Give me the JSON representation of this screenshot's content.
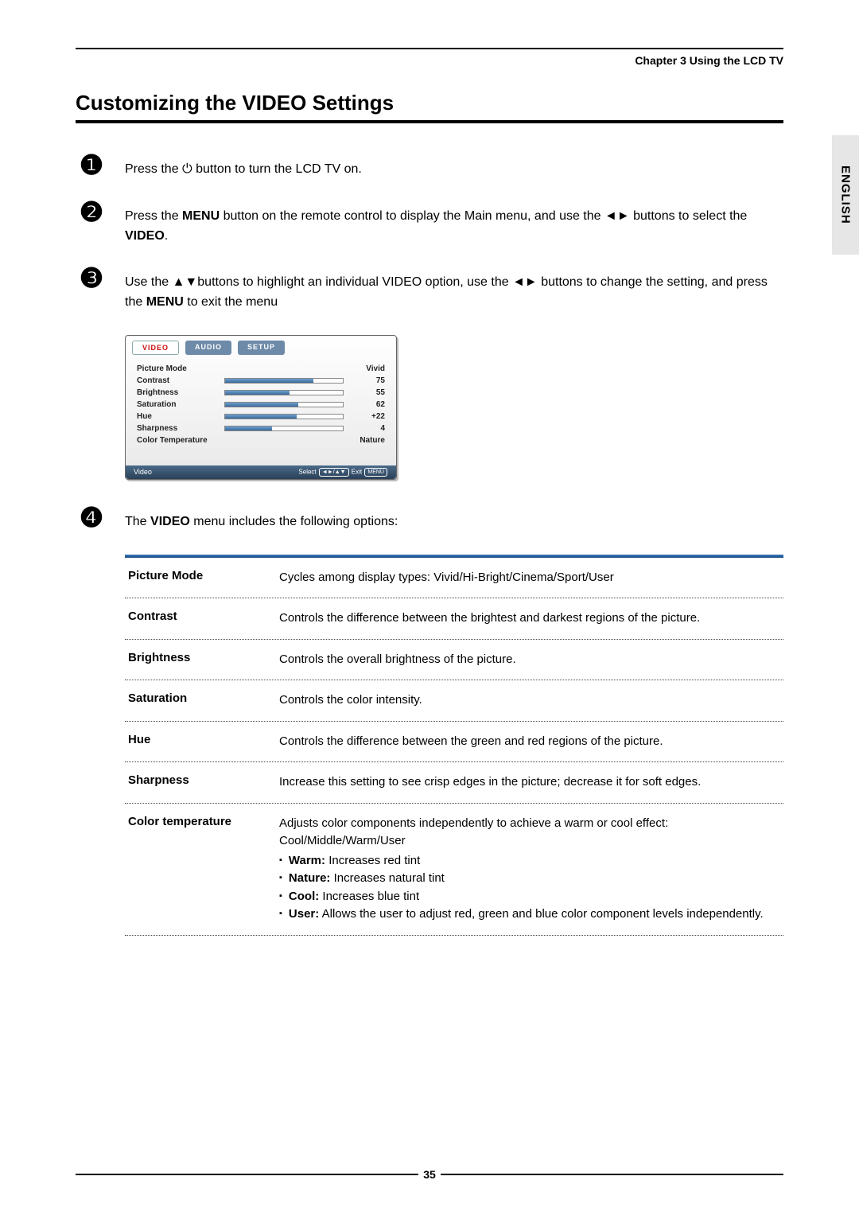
{
  "header": {
    "chapter": "Chapter 3 Using the LCD TV"
  },
  "title": "Customizing the VIDEO Settings",
  "side_tab": "ENGLISH",
  "steps": {
    "s1": {
      "num": "❶",
      "pre": "Press the ",
      "icon": "⏻",
      "post": " button to turn the LCD TV on."
    },
    "s2": {
      "num": "❷",
      "t1": "Press the ",
      "b1": "MENU",
      "t2": " button on the remote control to display the Main menu, and use the ",
      "arrows": "◄►",
      "t3": " buttons to select the ",
      "b2": "VIDEO",
      "t4": "."
    },
    "s3": {
      "num": "❸",
      "t1": "Use the ",
      "a1": "▲▼",
      "t2": "buttons to highlight an individual VIDEO option, use the ",
      "a2": "◄►",
      "t3": " buttons to change the setting, and press the ",
      "b1": "MENU",
      "t4": " to exit the menu"
    },
    "s4": {
      "num": "❹",
      "t1": "The ",
      "b1": "VIDEO",
      "t2": " menu includes the following options:"
    }
  },
  "menu": {
    "tabs": {
      "video": "VIDEO",
      "audio": "AUDIO",
      "setup": "SETUP"
    },
    "rows": {
      "pm": {
        "label": "Picture Mode",
        "value": "Vivid"
      },
      "con": {
        "label": "Contrast",
        "value": "75",
        "fill": 75
      },
      "bri": {
        "label": "Brightness",
        "value": "55",
        "fill": 55
      },
      "sat": {
        "label": "Saturation",
        "value": "62",
        "fill": 62
      },
      "hue": {
        "label": "Hue",
        "value": "+22",
        "fill": 61
      },
      "sha": {
        "label": "Sharpness",
        "value": "4",
        "fill": 40
      },
      "ct": {
        "label": "Color Temperature",
        "value": "Nature"
      }
    },
    "footer": {
      "left": "Video",
      "select": "Select",
      "nav": "◄►/▲▼",
      "exit": "Exit",
      "menu": "MENU"
    }
  },
  "opts": {
    "pm": {
      "name": "Picture Mode",
      "desc": "Cycles among display types: Vivid/Hi-Bright/Cinema/Sport/User"
    },
    "con": {
      "name": "Contrast",
      "desc": "Controls the difference between the brightest and darkest regions of the picture."
    },
    "bri": {
      "name": "Brightness",
      "desc": "Controls the overall brightness of the picture."
    },
    "sat": {
      "name": "Saturation",
      "desc": "Controls the color intensity."
    },
    "hue": {
      "name": "Hue",
      "desc": "Controls the difference between the green and red regions of the picture."
    },
    "sha": {
      "name": "Sharpness",
      "desc": "Increase this setting to see crisp edges in the picture; decrease it for soft edges."
    },
    "ct": {
      "name": "Color temperature",
      "desc": "Adjusts color components independently to achieve a warm or cool effect: Cool/Middle/Warm/User",
      "bullets": {
        "warm": {
          "b": "Warm:",
          "t": " Increases red tint"
        },
        "nature": {
          "b": "Nature:",
          "t": " Increases natural tint"
        },
        "cool": {
          "b": "Cool:",
          "t": " Increases blue tint"
        },
        "user": {
          "b": "User:",
          "t": " Allows the user to adjust red, green and blue color component levels independently."
        }
      }
    }
  },
  "page_number": "35"
}
